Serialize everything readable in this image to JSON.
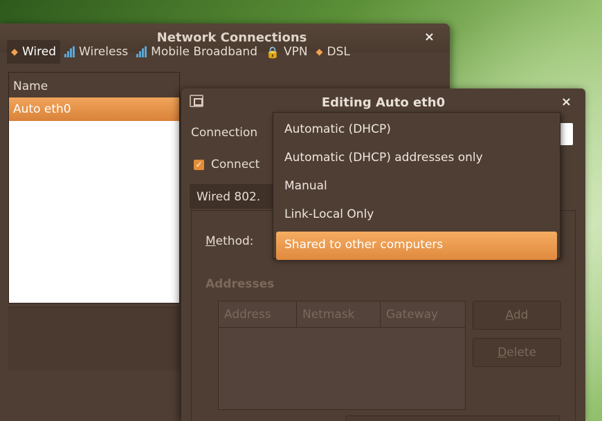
{
  "network_connections": {
    "title": "Network Connections",
    "close": "×",
    "tabs": [
      {
        "label": "Wired",
        "icon": "wired-icon",
        "active": true
      },
      {
        "label": "Wireless",
        "icon": "wireless-signal-icon"
      },
      {
        "label": "Mobile Broadband",
        "icon": "mobile-signal-icon"
      },
      {
        "label": "VPN",
        "icon": "lock-icon"
      },
      {
        "label": "DSL",
        "icon": "dsl-icon"
      }
    ],
    "list": {
      "header": "Name",
      "rows": [
        "Auto eth0"
      ]
    }
  },
  "editing_window": {
    "title": "Editing Auto eth0",
    "close": "×",
    "connection_label": "Connection",
    "connect_label": "Connect",
    "tab_label": "Wired  802.",
    "method_label_u": "M",
    "method_label_rest": "ethod:",
    "addresses_label": "Addresses",
    "table_columns": [
      "Address",
      "Netmask",
      "Gateway"
    ],
    "add_u": "A",
    "add_rest": "dd",
    "delete_u": "D",
    "delete_rest": "elete"
  },
  "method_dropdown": {
    "options": [
      "Automatic (DHCP)",
      "Automatic (DHCP) addresses only",
      "Manual",
      "Link-Local Only",
      "Shared to other computers"
    ],
    "selected_index": 4
  },
  "colors": {
    "window_bg": "#4f3e33",
    "accent": "#e58c36",
    "text": "#e7ddd2",
    "disabled_text": "#7b695b"
  }
}
